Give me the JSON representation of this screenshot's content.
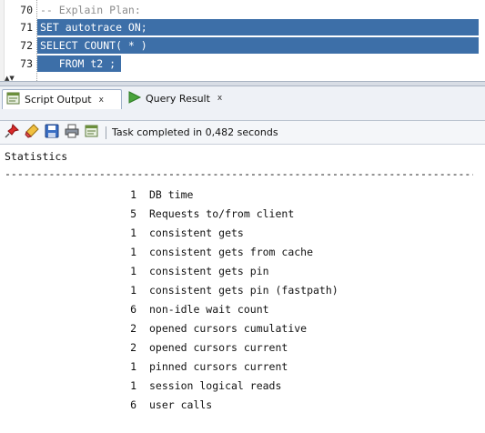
{
  "editor": {
    "lines": [
      {
        "num": "70",
        "text": "-- Explain Plan:",
        "style": "comment"
      },
      {
        "num": "71",
        "text": "SET autotrace ON;",
        "style": "selected"
      },
      {
        "num": "72",
        "text": "SELECT COUNT( * )",
        "style": "selected"
      },
      {
        "num": "73",
        "text": "   FROM t2 ;",
        "style": "selected"
      }
    ],
    "selection_color": "#3d6fa8"
  },
  "tabs": [
    {
      "label": "Script Output",
      "close": "x",
      "icon": "script-icon",
      "active": true
    },
    {
      "label": "Query Result",
      "close": "x",
      "icon": "play-arrow-icon",
      "active": false
    }
  ],
  "toolbar": {
    "buttons": [
      "pin-icon",
      "eraser-icon",
      "save-icon",
      "print-icon",
      "script-icon"
    ],
    "status": "Task completed in 0,482 seconds"
  },
  "output": {
    "heading": "Statistics",
    "rule": "------------------------------------------------------------------------------------------------",
    "stats": [
      {
        "value": "1",
        "name": "DB time"
      },
      {
        "value": "5",
        "name": "Requests to/from client"
      },
      {
        "value": "1",
        "name": "consistent gets"
      },
      {
        "value": "1",
        "name": "consistent gets from cache"
      },
      {
        "value": "1",
        "name": "consistent gets pin"
      },
      {
        "value": "1",
        "name": "consistent gets pin (fastpath)"
      },
      {
        "value": "6",
        "name": "non-idle wait count"
      },
      {
        "value": "2",
        "name": "opened cursors cumulative"
      },
      {
        "value": "2",
        "name": "opened cursors current"
      },
      {
        "value": "1",
        "name": "pinned cursors current"
      },
      {
        "value": "1",
        "name": "session logical reads"
      },
      {
        "value": "6",
        "name": "user calls"
      }
    ]
  }
}
